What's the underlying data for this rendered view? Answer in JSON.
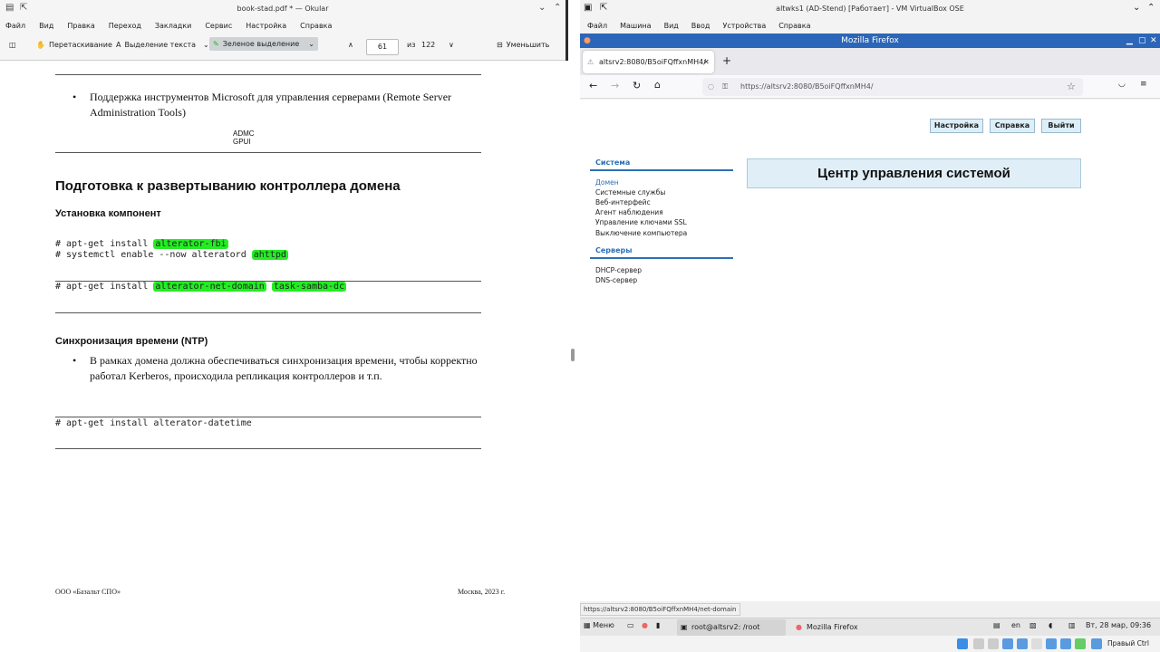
{
  "okular": {
    "title": "book-stad.pdf * — Okular",
    "menu": [
      "Файл",
      "Вид",
      "Правка",
      "Переход",
      "Закладки",
      "Сервис",
      "Настройка",
      "Справка"
    ],
    "toolbar": {
      "drag": "Перетаскивание",
      "text_select": "Выделение текста",
      "green_select": "Зеленое выделение",
      "page_current": "61",
      "page_of": "из",
      "page_total": "122",
      "zoom_out": "Уменьшить"
    },
    "page": {
      "bullet1_line1": "Поддержка инструментов Microsoft для управления серверами (Remote Server",
      "bullet1_line2": "Administration Tools)",
      "admc": "ADMC",
      "gpui": "GPUI",
      "heading": "Подготовка к развертыванию контроллера домена",
      "subheading1": "Установка компонент",
      "code1a_prefix": "# apt-get install ",
      "code1a_hl": "alterator-fbi",
      "code1b_prefix": "# systemctl enable --now alteratord ",
      "code1b_hl": "ahttpd",
      "code2_prefix": "# apt-get install ",
      "code2_hl1": "alterator-net-domain",
      "code2_hl2": "task-samba-dc",
      "subheading2": "Синхронизация времени (NTP)",
      "bullet2_line1": "В рамках домена должна обеспечиваться синхронизация времени, чтобы корректно",
      "bullet2_line2": "работал Kerberos, происходила репликация контроллеров и т.п.",
      "code3": "# apt-get install alterator-datetime",
      "footer_left": "ООО «Базальт СПО»",
      "footer_right": "Москва, 2023 г."
    }
  },
  "vbox": {
    "title": "altwks1 (AD-Stend) [Работает] - VM VirtualBox OSE",
    "menu": [
      "Файл",
      "Машина",
      "Вид",
      "Ввод",
      "Устройства",
      "Справка"
    ],
    "firefox": {
      "window_title": "Mozilla Firefox",
      "tab_label": "altsrv2:8080/B5oiFQffxnMH4/",
      "url": "https://altsrv2:8080/B5oiFQffxnMH4/",
      "status_url": "https://altsrv2:8080/B5oiFQffxnMH4/net-domain",
      "page": {
        "btn_settings": "Настройка",
        "btn_help": "Справка",
        "btn_exit": "Выйти",
        "section_system": "Система",
        "system_items": [
          "Домен",
          "Системные службы",
          "Веб-интерфейс",
          "Агент наблюдения",
          "Управление ключами SSL",
          "Выключение компьютера"
        ],
        "section_servers": "Серверы",
        "server_items": [
          "DHCP-сервер",
          "DNS-сервер"
        ],
        "main_title": "Центр управления системой"
      }
    },
    "taskbar": {
      "menu": "Меню",
      "task_terminal": "root@altsrv2: /root",
      "task_firefox": "Mozilla Firefox",
      "lang": "en",
      "clock": "Вт, 28 мар, 09:36"
    },
    "host_key": "Правый Ctrl"
  }
}
